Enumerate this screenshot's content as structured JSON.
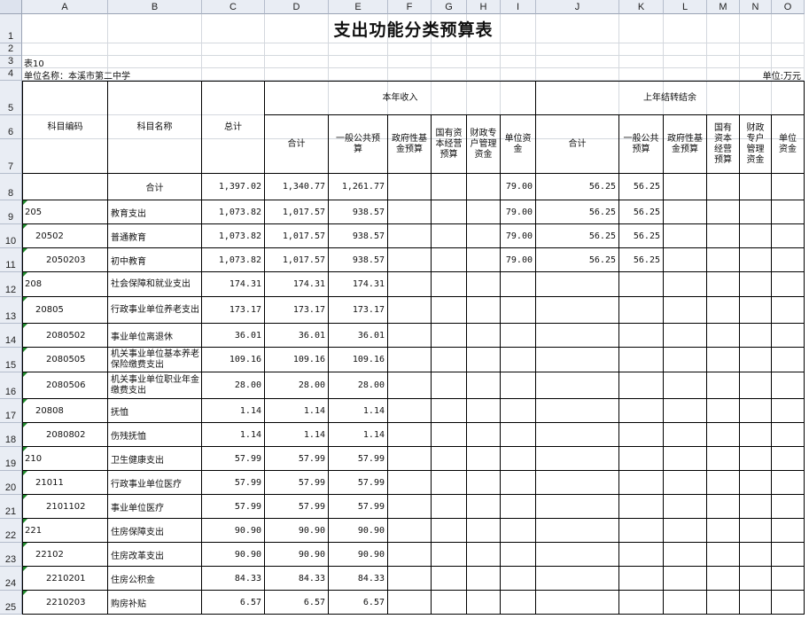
{
  "columns": [
    "A",
    "B",
    "C",
    "D",
    "E",
    "F",
    "G",
    "H",
    "I",
    "J",
    "K",
    "L",
    "M",
    "N",
    "O"
  ],
  "rows": [
    "1",
    "2",
    "3",
    "4",
    "5",
    "6",
    "7",
    "8",
    "9",
    "10",
    "11",
    "12",
    "13",
    "14",
    "15",
    "16",
    "17",
    "18",
    "19",
    "20",
    "21",
    "22",
    "23",
    "24",
    "25"
  ],
  "sheet": {
    "title": "支出功能分类预算表",
    "table_no": "表10",
    "unit_name": "单位名称：本溪市第二中学",
    "unit": "单位:万元"
  },
  "header": {
    "code": "科目编码",
    "name": "科目名称",
    "total": "总计",
    "current_income": "本年收入",
    "prior_carryover": "上年结转结余",
    "cur_total": "合计",
    "cur_general": "一般公共预算",
    "cur_fund": "政府性基金预算",
    "cur_state": "国有资本经营预算",
    "cur_special": "财政专户管理资金",
    "cur_unit": "单位资金",
    "pri_total": "合计",
    "pri_general": "一般公共预算",
    "pri_fund": "政府性基金预算",
    "pri_state": "国有资本经营预算",
    "pri_special": "财政专户管理资金",
    "pri_unit": "单位资金"
  },
  "data_rows": [
    {
      "code": "",
      "name": "合计",
      "total": "1,397.02",
      "c_total": "1,340.77",
      "c_general": "1,261.77",
      "c_unit": "79.00",
      "p_total": "56.25",
      "p_general": "56.25"
    },
    {
      "code": "205",
      "name": "教育支出",
      "total": "1,073.82",
      "c_total": "1,017.57",
      "c_general": "938.57",
      "c_unit": "79.00",
      "p_total": "56.25",
      "p_general": "56.25"
    },
    {
      "code": "20502",
      "name": "普通教育",
      "total": "1,073.82",
      "c_total": "1,017.57",
      "c_general": "938.57",
      "c_unit": "79.00",
      "p_total": "56.25",
      "p_general": "56.25"
    },
    {
      "code": "2050203",
      "name": "初中教育",
      "total": "1,073.82",
      "c_total": "1,017.57",
      "c_general": "938.57",
      "c_unit": "79.00",
      "p_total": "56.25",
      "p_general": "56.25"
    },
    {
      "code": "208",
      "name": "社会保障和就业支出",
      "total": "174.31",
      "c_total": "174.31",
      "c_general": "174.31",
      "c_unit": "",
      "p_total": "",
      "p_general": ""
    },
    {
      "code": "20805",
      "name": "行政事业单位养老支出",
      "total": "173.17",
      "c_total": "173.17",
      "c_general": "173.17",
      "c_unit": "",
      "p_total": "",
      "p_general": ""
    },
    {
      "code": "2080502",
      "name": "事业单位离退休",
      "total": "36.01",
      "c_total": "36.01",
      "c_general": "36.01",
      "c_unit": "",
      "p_total": "",
      "p_general": ""
    },
    {
      "code": "2080505",
      "name": "机关事业单位基本养老保险缴费支出",
      "total": "109.16",
      "c_total": "109.16",
      "c_general": "109.16",
      "c_unit": "",
      "p_total": "",
      "p_general": ""
    },
    {
      "code": "2080506",
      "name": "机关事业单位职业年金缴费支出",
      "total": "28.00",
      "c_total": "28.00",
      "c_general": "28.00",
      "c_unit": "",
      "p_total": "",
      "p_general": ""
    },
    {
      "code": "20808",
      "name": "抚恤",
      "total": "1.14",
      "c_total": "1.14",
      "c_general": "1.14",
      "c_unit": "",
      "p_total": "",
      "p_general": ""
    },
    {
      "code": "2080802",
      "name": "伤残抚恤",
      "total": "1.14",
      "c_total": "1.14",
      "c_general": "1.14",
      "c_unit": "",
      "p_total": "",
      "p_general": ""
    },
    {
      "code": "210",
      "name": "卫生健康支出",
      "total": "57.99",
      "c_total": "57.99",
      "c_general": "57.99",
      "c_unit": "",
      "p_total": "",
      "p_general": ""
    },
    {
      "code": "21011",
      "name": "行政事业单位医疗",
      "total": "57.99",
      "c_total": "57.99",
      "c_general": "57.99",
      "c_unit": "",
      "p_total": "",
      "p_general": ""
    },
    {
      "code": "2101102",
      "name": "事业单位医疗",
      "total": "57.99",
      "c_total": "57.99",
      "c_general": "57.99",
      "c_unit": "",
      "p_total": "",
      "p_general": ""
    },
    {
      "code": "221",
      "name": "住房保障支出",
      "total": "90.90",
      "c_total": "90.90",
      "c_general": "90.90",
      "c_unit": "",
      "p_total": "",
      "p_general": ""
    },
    {
      "code": "22102",
      "name": "住房改革支出",
      "total": "90.90",
      "c_total": "90.90",
      "c_general": "90.90",
      "c_unit": "",
      "p_total": "",
      "p_general": ""
    },
    {
      "code": "2210201",
      "name": "住房公积金",
      "total": "84.33",
      "c_total": "84.33",
      "c_general": "84.33",
      "c_unit": "",
      "p_total": "",
      "p_general": ""
    },
    {
      "code": "2210203",
      "name": "购房补贴",
      "total": "6.57",
      "c_total": "6.57",
      "c_general": "6.57",
      "c_unit": "",
      "p_total": "",
      "p_general": ""
    }
  ]
}
